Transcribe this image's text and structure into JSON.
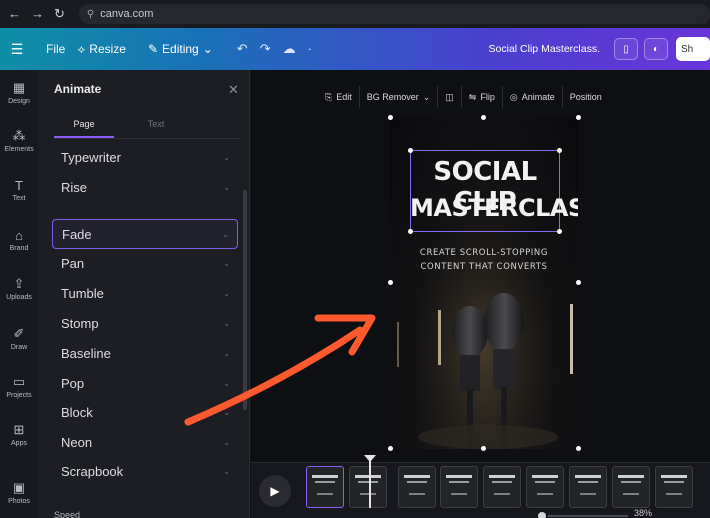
{
  "browser": {
    "url": "canva.com"
  },
  "header": {
    "file_label": "File",
    "resize_label": "Resize",
    "editing_label": "Editing",
    "doc_title": "Social Clip Masterclass.",
    "share_label": "Sh"
  },
  "rail": {
    "items": [
      {
        "label": "Design",
        "icon": "layout-icon"
      },
      {
        "label": "Elements",
        "icon": "shapes-icon"
      },
      {
        "label": "Text",
        "icon": "text-icon"
      },
      {
        "label": "Brand",
        "icon": "brand-icon"
      },
      {
        "label": "Uploads",
        "icon": "upload-icon"
      },
      {
        "label": "Draw",
        "icon": "pen-icon"
      },
      {
        "label": "Projects",
        "icon": "folder-icon"
      },
      {
        "label": "Apps",
        "icon": "apps-icon"
      },
      {
        "label": "Photos",
        "icon": "photo-icon"
      }
    ]
  },
  "panel": {
    "title": "Animate",
    "tabs": [
      "Page",
      "Text"
    ],
    "items": [
      "Typewriter",
      "Rise",
      "Fade",
      "Pan",
      "Tumble",
      "Stomp",
      "Baseline",
      "Pop",
      "Block",
      "Neon",
      "Scrapbook"
    ],
    "selected": "Fade",
    "speed_label": "Speed"
  },
  "toolbar": {
    "edit": "Edit",
    "bg_remover": "BG Remover",
    "flip": "Flip",
    "animate": "Animate",
    "position": "Position"
  },
  "poster": {
    "title_line1": "SOCIAL CLIP",
    "title_line2": "MASTERCLASS",
    "sub_line1": "CREATE SCROLL-STOPPING",
    "sub_line2": "CONTENT THAT CONVERTS"
  },
  "timeline": {
    "zoom": "38%"
  },
  "colors": {
    "accent": "#8b5cf6",
    "arrow": "#ff5a2e"
  }
}
